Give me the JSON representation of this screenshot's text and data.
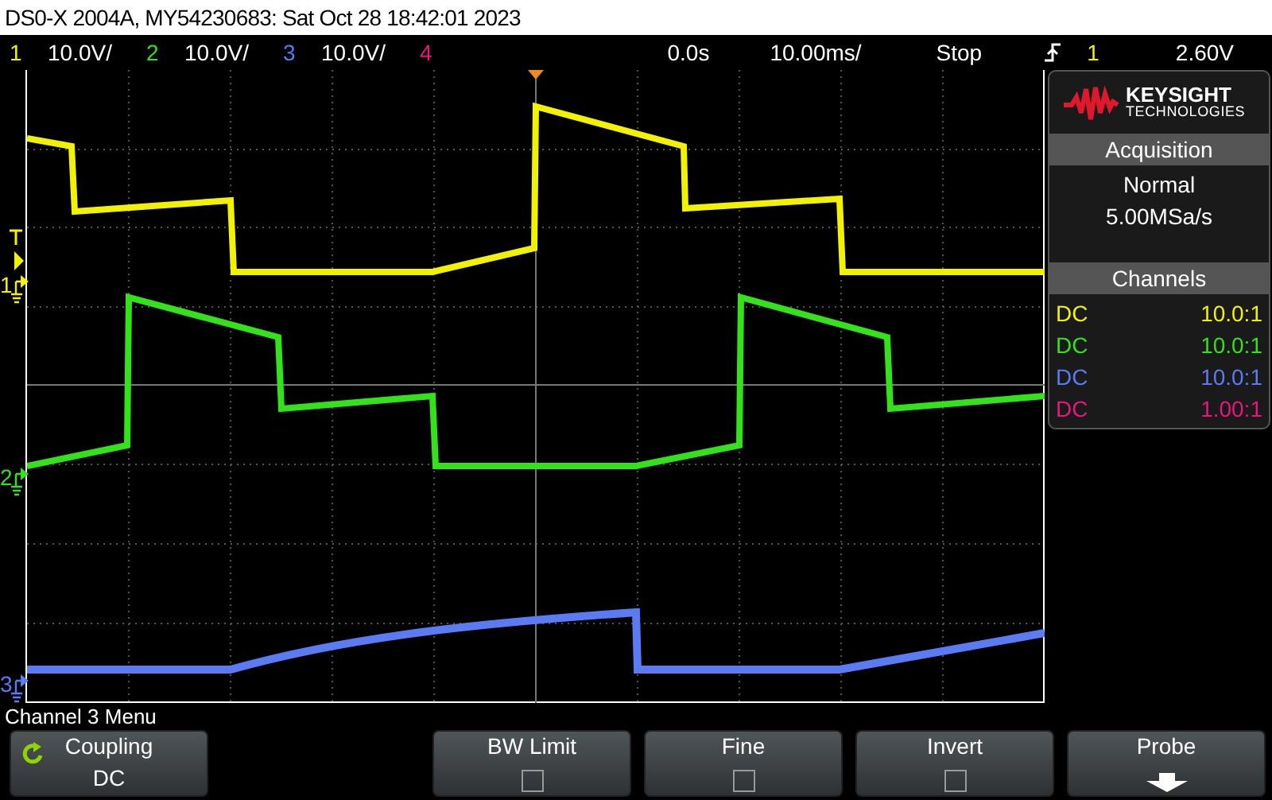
{
  "title": "DS0-X 2004A, MY54230683: Sat Oct 28 18:42:01 2023",
  "channels": [
    {
      "number": "1",
      "scale": "10.0V/",
      "color": "#f2f200"
    },
    {
      "number": "2",
      "scale": "10.0V/",
      "color": "#33e21a"
    },
    {
      "number": "3",
      "scale": "10.0V/",
      "color": "#5b7bf2"
    },
    {
      "number": "4",
      "color": "#e8177f"
    }
  ],
  "timebase": {
    "delay": "0.0s",
    "scale": "10.00ms/"
  },
  "run_state": "Stop",
  "trigger": {
    "source": "1",
    "level": "2.60V"
  },
  "ground_markers": [
    {
      "label": "1"
    },
    {
      "label": "2"
    },
    {
      "label": "3"
    }
  ],
  "brand": {
    "name": "KEYSIGHT",
    "sub": "TECHNOLOGIES"
  },
  "acquisition": {
    "title": "Acquisition",
    "mode": "Normal",
    "rate": "5.00MSa/s"
  },
  "channel_panel": {
    "title": "Channels",
    "rows": [
      {
        "coupling": "DC",
        "probe": "10.0:1"
      },
      {
        "coupling": "DC",
        "probe": "10.0:1"
      },
      {
        "coupling": "DC",
        "probe": "10.0:1"
      },
      {
        "coupling": "DC",
        "probe": "1.00:1"
      }
    ]
  },
  "menu_title": "Channel 3 Menu",
  "softkeys": [
    {
      "kind": "value",
      "label": "Coupling",
      "value": "DC"
    },
    {
      "kind": "blank"
    },
    {
      "kind": "checkbox",
      "label": "BW Limit",
      "checked": false
    },
    {
      "kind": "checkbox",
      "label": "Fine",
      "checked": false
    },
    {
      "kind": "checkbox",
      "label": "Invert",
      "checked": false
    },
    {
      "kind": "submenu",
      "label": "Probe"
    }
  ]
}
